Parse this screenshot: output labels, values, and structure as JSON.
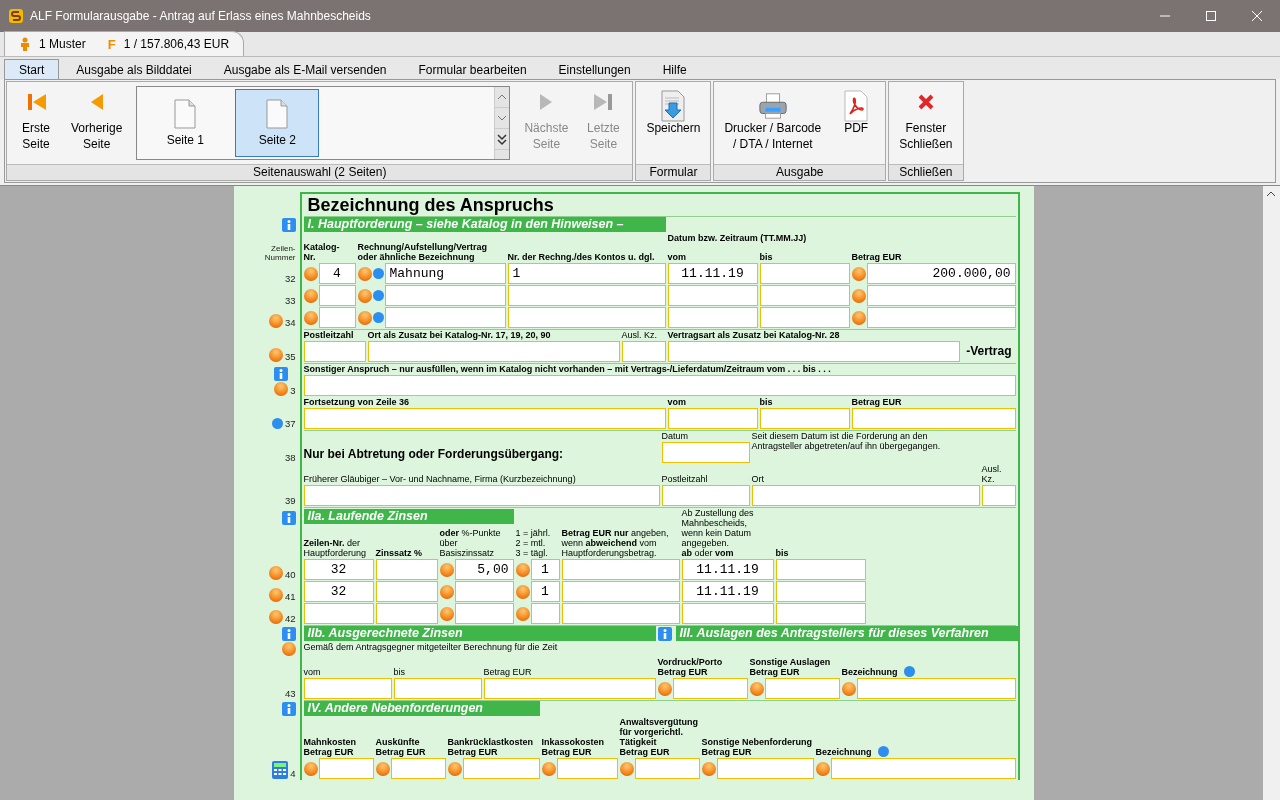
{
  "window": {
    "title": "ALF Formularausgabe - Antrag auf Erlass eines Mahnbescheids"
  },
  "header": {
    "user": "1 Muster",
    "form_glyph": "F",
    "forms": "1 / 157.806,43 EUR"
  },
  "tabs": [
    {
      "label": "Start",
      "selected": true
    },
    {
      "label": "Ausgabe als Bilddatei",
      "selected": false
    },
    {
      "label": "Ausgabe als E-Mail versenden",
      "selected": false
    },
    {
      "label": "Formular bearbeiten",
      "selected": false
    },
    {
      "label": "Einstellungen",
      "selected": false
    },
    {
      "label": "Hilfe",
      "selected": false
    }
  ],
  "ribbon": {
    "nav_left": [
      {
        "label": "Erste\nSeite",
        "kind": "first",
        "disabled": false
      },
      {
        "label": "Vorherige\nSeite",
        "kind": "prev",
        "disabled": false
      }
    ],
    "pages": [
      {
        "label": "Seite 1",
        "selected": false
      },
      {
        "label": "Seite 2",
        "selected": true
      }
    ],
    "nav_right": [
      {
        "label": "Nächste\nSeite",
        "kind": "next",
        "disabled": true
      },
      {
        "label": "Letzte\nSeite",
        "kind": "last",
        "disabled": true
      }
    ],
    "caption": "Seitenauswahl (2 Seiten)",
    "groups": [
      {
        "caption": "Formular",
        "buttons": [
          {
            "label": "Speichern",
            "kind": "save",
            "disabled": false
          }
        ]
      },
      {
        "caption": "Ausgabe",
        "buttons": [
          {
            "label": "Drucker / Barcode\n/ DTA / Internet",
            "kind": "printer",
            "disabled": false
          },
          {
            "label": "PDF",
            "kind": "pdf",
            "disabled": false
          }
        ]
      },
      {
        "caption": "Schließen",
        "buttons": [
          {
            "label": "Fenster\nSchließen",
            "kind": "close",
            "disabled": false
          }
        ]
      }
    ]
  },
  "form": {
    "title": "Bezeichnung des Anspruchs",
    "sections": [
      {
        "kind": "haupt",
        "headings": [
          {
            "text": "I. Hauptforderung – siehe Katalog in den Hinweisen –",
            "info": true
          }
        ],
        "gutter_label": "Zeilen-\nNummer",
        "headers": [
          {
            "kind": "label",
            "text": "Katalog-\nNr."
          },
          {
            "kind": "label",
            "text": "Rechnung/Aufstellung/Vertrag\noder ähnliche Bezeichnung"
          },
          {
            "kind": "label",
            "text": "Nr. der Rechng./des Kontos u. dgl."
          },
          {
            "kind": "label",
            "text": "Datum bzw. Zeitraum (TT.MM.JJ)"
          },
          {
            "kind": "label",
            "text": "vom"
          },
          {
            "kind": "label",
            "text": "bis"
          },
          {
            "kind": "label",
            "text": "Betrag EUR"
          }
        ],
        "rows": [
          {
            "num": "32",
            "icons": [],
            "cells": [
              {
                "kind": "field",
                "picker": true,
                "value": "4"
              },
              {
                "kind": "field",
                "picker": true,
                "dot": true,
                "value": "Mahnung"
              },
              {
                "kind": "field",
                "value": "1"
              },
              {
                "kind": "field",
                "value": "11.11.19"
              },
              {
                "kind": "field"
              },
              {
                "kind": "field",
                "picker": true,
                "value": "200.000,00"
              }
            ]
          },
          {
            "num": "33",
            "icons": [],
            "cells": [
              {
                "kind": "field",
                "picker": true
              },
              {
                "kind": "field",
                "picker": true,
                "dot": true
              },
              {
                "kind": "field"
              },
              {
                "kind": "field"
              },
              {
                "kind": "field"
              },
              {
                "kind": "field",
                "picker": true
              }
            ]
          },
          {
            "num": "34",
            "icons": [
              {
                "kind": "picker"
              }
            ],
            "cells": [
              {
                "kind": "field",
                "picker": true
              },
              {
                "kind": "field",
                "picker": true,
                "dot": true
              },
              {
                "kind": "field"
              },
              {
                "kind": "field"
              },
              {
                "kind": "field"
              },
              {
                "kind": "field",
                "picker": true
              }
            ]
          }
        ]
      },
      {
        "kind": "zusatz",
        "rows": [
          {
            "num": "35",
            "icons": [
              {
                "kind": "picker"
              }
            ],
            "cells": [
              {
                "kind": "input",
                "label": "Postleitzahl"
              },
              {
                "kind": "input",
                "label": "Ort als Zusatz bei Katalog-Nr. 17, 19, 20, 90"
              },
              {
                "kind": "input-light",
                "label": "Ausl. Kz."
              },
              {
                "kind": "input",
                "label": "Vertragsart als Zusatz bei Katalog-Nr. 28"
              },
              {
                "kind": "suffix",
                "text": "-Vertrag"
              }
            ]
          }
        ]
      },
      {
        "kind": "sonst",
        "rows": [
          {
            "num": "3",
            "icons": [
              {
                "kind": "info"
              },
              {
                "kind": "picker"
              }
            ],
            "cells": [
              {
                "kind": "input-rich",
                "label": "**Sonstiger Anspruch – nur ausfüllen, wenn im Katalog nicht vorhanden –** mit Vertrags-/Lieferdatum/Zeitraum vom . . . bis . . ."
              }
            ]
          },
          {
            "num": "37",
            "icons": [
              {
                "kind": "dot"
              }
            ],
            "cells": [
              {
                "kind": "input",
                "label": "Fortsetzung von Zeile 36"
              },
              {
                "kind": "input",
                "label": "vom"
              },
              {
                "kind": "input",
                "label": "bis"
              },
              {
                "kind": "input",
                "label": "Betrag EUR"
              }
            ]
          }
        ]
      },
      {
        "kind": "abtretung",
        "rows": [
          {
            "num": "38",
            "icons": [],
            "cells": [
              {
                "kind": "subhead",
                "text": "Nur bei Abtretung oder Forderungsübergang:"
              },
              {
                "kind": "input-light",
                "label": "Datum"
              },
              {
                "kind": "note",
                "text": "Seit diesem Datum ist die Forderung an den\nAntragsteller abgetreten/auf ihn übergegangen."
              }
            ]
          },
          {
            "num": "39",
            "icons": [],
            "cells": [
              {
                "kind": "input-light",
                "label": "Früherer Gläubiger – Vor- und Nachname, Firma (Kurzbezeichnung)"
              },
              {
                "kind": "input-light",
                "label": "Postleitzahl"
              },
              {
                "kind": "input-light",
                "label": "Ort"
              },
              {
                "kind": "input-light",
                "label": "Ausl. Kz."
              }
            ]
          }
        ]
      },
      {
        "kind": "zinsen",
        "headings": [
          {
            "text": "IIa. Laufende Zinsen",
            "info": true
          }
        ],
        "headers": [
          {
            "kind": "note",
            "text": "**Zeilen-Nr.** der\nHauptforderung"
          },
          {
            "kind": "label",
            "text": "Zinssatz %"
          },
          {
            "kind": "note",
            "text": "**oder** %-Punkte über\nBasiszinssatz"
          },
          {
            "kind": "note",
            "text": "1 = jährl.\n2 = mtl.\n3 = tägl."
          },
          {
            "kind": "note",
            "text": "**Betrag EUR nur** angeben,\nwenn **abweichend** vom\nHauptforderungsbetrag."
          },
          {
            "kind": "note",
            "text": "Ab Zustellung des Mahnbescheids,\nwenn kein Datum angegeben.\n**ab** oder **vom**"
          },
          {
            "kind": "label",
            "text": "bis"
          }
        ],
        "rows": [
          {
            "num": "40",
            "icons": [
              {
                "kind": "picker"
              }
            ],
            "cells": [
              {
                "kind": "field",
                "value": "32"
              },
              {
                "kind": "field"
              },
              {
                "kind": "field",
                "picker": true,
                "value": "5,00"
              },
              {
                "kind": "field",
                "picker": true,
                "value": "1"
              },
              {
                "kind": "field"
              },
              {
                "kind": "field",
                "value": "11.11.19"
              },
              {
                "kind": "field"
              }
            ]
          },
          {
            "num": "41",
            "icons": [
              {
                "kind": "picker"
              }
            ],
            "cells": [
              {
                "kind": "field",
                "value": "32"
              },
              {
                "kind": "field"
              },
              {
                "kind": "field",
                "picker": true
              },
              {
                "kind": "field",
                "picker": true,
                "value": "1"
              },
              {
                "kind": "field"
              },
              {
                "kind": "field",
                "value": "11.11.19"
              },
              {
                "kind": "field"
              }
            ]
          },
          {
            "num": "42",
            "icons": [
              {
                "kind": "picker"
              }
            ],
            "cells": [
              {
                "kind": "field"
              },
              {
                "kind": "field"
              },
              {
                "kind": "field",
                "picker": true
              },
              {
                "kind": "field",
                "picker": true
              },
              {
                "kind": "field"
              },
              {
                "kind": "field"
              },
              {
                "kind": "field"
              }
            ]
          }
        ]
      },
      {
        "kind": "iib",
        "headings": [
          {
            "text": "IIb. Ausgerechnete Zinsen",
            "info": true
          },
          {
            "text": "III. Auslagen des Antragstellers für dieses Verfahren",
            "info": true
          }
        ],
        "intro": {
          "text": "Gemäß dem Antragsgegner mitgeteilter Berechnung für die Zeit",
          "icons": [
            {
              "kind": "picker"
            }
          ]
        },
        "rows": [
          {
            "num": "43",
            "icons": [],
            "cells": [
              {
                "kind": "input-light",
                "label": "vom"
              },
              {
                "kind": "input-light",
                "label": "bis"
              },
              {
                "kind": "input-light",
                "label": "Betrag EUR"
              },
              {
                "kind": "input",
                "label": "Vordruck/Porto\nBetrag EUR",
                "picker": true
              },
              {
                "kind": "input",
                "label": "Sonstige Auslagen\nBetrag EUR",
                "picker": true
              },
              {
                "kind": "input",
                "label": "Bezeichnung",
                "picker": true,
                "dot": true
              }
            ]
          }
        ]
      },
      {
        "kind": "neben",
        "headings": [
          {
            "text": "IV. Andere Nebenforderungen",
            "info": true
          }
        ],
        "rows": [
          {
            "num": "4",
            "icons": [
              {
                "kind": "calc"
              }
            ],
            "cells": [
              {
                "kind": "input",
                "label": "Mahnkosten\nBetrag EUR",
                "picker": true
              },
              {
                "kind": "input",
                "label": "Auskünfte\nBetrag EUR",
                "picker": true
              },
              {
                "kind": "input",
                "label": "Bankrücklastkosten\nBetrag EUR",
                "picker": true
              },
              {
                "kind": "input",
                "label": "Inkassokosten\nBetrag EUR",
                "picker": true
              },
              {
                "kind": "input",
                "label": "Anwaltsvergütung\nfür vorgerichtl.\nTätigkeit\nBetrag EUR",
                "picker": true
              },
              {
                "kind": "input",
                "label": "Sonstige Nebenforderung\nBetrag EUR",
                "picker": true
              },
              {
                "kind": "input",
                "label": "Bezeichnung",
                "picker": true,
                "dot": true
              }
            ]
          }
        ]
      }
    ]
  }
}
